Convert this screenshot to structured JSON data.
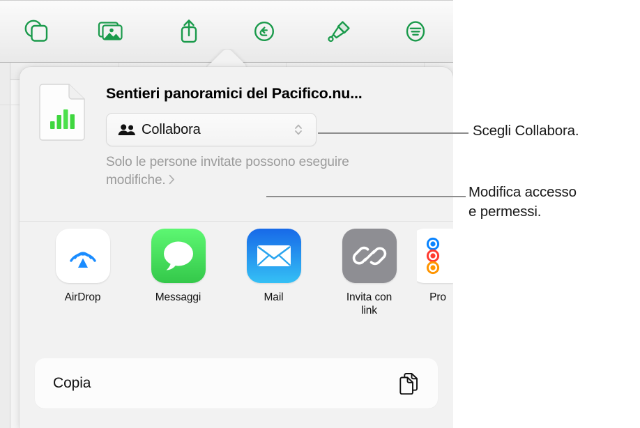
{
  "toolbar": {
    "items": [
      {
        "name": "shapes-icon",
        "label": "Forme"
      },
      {
        "name": "media-icon",
        "label": "Media"
      },
      {
        "name": "share-icon",
        "label": "Condividi"
      },
      {
        "name": "undo-icon",
        "label": "Annulla"
      },
      {
        "name": "format-brush-icon",
        "label": "Formato"
      },
      {
        "name": "document-options-icon",
        "label": "Opzioni documento"
      }
    ]
  },
  "popover": {
    "document_title": "Sentieri panoramici del Pacifico.nu...",
    "document_icon": "numbers-document-icon",
    "collaborate_button": {
      "label": "Collabora",
      "icon": "two-people-icon",
      "chevron": "up-down-chevron-icon"
    },
    "permissions": {
      "text": "Solo le persone invitate possono eseguire modifiche.",
      "disclosure": "›"
    },
    "apps": [
      {
        "name": "airdrop",
        "label": "AirDrop",
        "color": "#ffffff"
      },
      {
        "name": "messages",
        "label": "Messaggi",
        "color": "#4cd964"
      },
      {
        "name": "mail",
        "label": "Mail",
        "color": "#1f7cf2"
      },
      {
        "name": "copy-link",
        "label": "Invita con\nlink",
        "color": "#8e8e93"
      },
      {
        "name": "reminders",
        "label": "Pro",
        "color": "#ffffff"
      }
    ],
    "actions": [
      {
        "name": "copy",
        "label": "Copia",
        "icon": "copy-documents-icon"
      }
    ]
  },
  "callouts": [
    {
      "name": "callout-collabora",
      "text": "Scegli Collabora."
    },
    {
      "name": "callout-permessi",
      "text": "Modifica accesso\ne permessi."
    }
  ],
  "colors": {
    "accent_green": "#1a9a4b",
    "airdrop_blue": "#1a8cff",
    "messages_green": "#4cd964",
    "mail_blue": "#1f7cf2",
    "link_gray": "#8e8e93",
    "reminder_blue": "#0a84ff",
    "reminder_red": "#ff3b30",
    "reminder_orange": "#ff9500",
    "muted_text": "#9a9a9a",
    "leader_line": "#8d8d8d"
  }
}
